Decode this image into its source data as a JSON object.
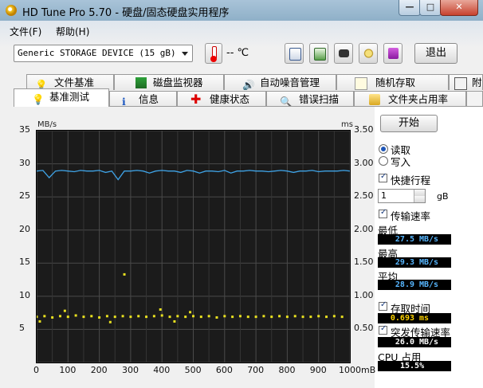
{
  "window": {
    "title": "HD Tune Pro 5.70 - 硬盘/固态硬盘实用程序",
    "min_label": "—",
    "max_label": "□",
    "close_label": "✕"
  },
  "menu": {
    "file": "文件(F)",
    "help": "帮助(H)"
  },
  "toolbar": {
    "device": "Generic STORAGE DEVICE (15 gB)",
    "temperature": "-- ℃",
    "exit_label": "退出",
    "icons": [
      "copy-text-icon",
      "copy-info-icon",
      "camera-icon",
      "options-icon",
      "save-icon"
    ]
  },
  "tabs": {
    "row1": [
      "文件基准",
      "磁盘监视器",
      "自动噪音管理",
      "随机存取",
      "附"
    ],
    "row2": [
      "基准测试",
      "信息",
      "健康状态",
      "错误扫描",
      "文件夹占用率"
    ]
  },
  "graph": {
    "left_unit": "MB/s",
    "right_unit": "ms"
  },
  "side": {
    "start_label": "开始",
    "read_label": "读取",
    "write_label": "写入",
    "short_stroke_label": "快捷行程",
    "short_stroke_value": "1",
    "short_stroke_unit": "gB",
    "transfer_rate_label": "传输速率",
    "min_label": "最低",
    "min_value": "27.5",
    "min_unit": "MB/s",
    "max_label": "最高",
    "max_value": "29.3",
    "max_unit": "MB/s",
    "avg_label": "平均",
    "avg_value": "28.9",
    "avg_unit": "MB/s",
    "access_time_label": "存取时间",
    "access_time_value": "0.693",
    "access_time_unit": "ms",
    "burst_rate_label": "突发传输速率",
    "burst_rate_value": "26.0",
    "burst_rate_unit": "MB/s",
    "cpu_label": "CPU 占用",
    "cpu_value": "15.5%"
  },
  "chart_data": {
    "type": "line",
    "x_ticks": [
      "0",
      "100",
      "200",
      "300",
      "400",
      "500",
      "600",
      "700",
      "800",
      "900",
      "1000mB"
    ],
    "xlim": [
      0,
      1000
    ],
    "y_left_ticks": [
      "35",
      "30",
      "25",
      "20",
      "15",
      "10",
      "5"
    ],
    "y_right_ticks": [
      "3.50",
      "3.00",
      "2.50",
      "2.00",
      "1.50",
      "1.00",
      "0.50"
    ],
    "ylim_left": [
      0,
      35
    ],
    "ylim_right": [
      0,
      3.5
    ],
    "grid": true,
    "series": [
      {
        "color": "#3fa3e6",
        "axis": "left",
        "x": [
          0,
          20,
          40,
          60,
          80,
          100,
          120,
          140,
          160,
          180,
          200,
          220,
          240,
          260,
          280,
          300,
          320,
          340,
          360,
          380,
          400,
          420,
          440,
          460,
          480,
          500,
          520,
          540,
          560,
          580,
          600,
          620,
          640,
          660,
          680,
          700,
          720,
          740,
          760,
          780,
          800,
          820,
          840,
          860,
          880,
          900,
          920,
          940,
          960,
          980,
          1000
        ],
        "y": [
          28.9,
          29.0,
          27.9,
          28.9,
          29.0,
          28.9,
          28.8,
          29.0,
          28.9,
          28.9,
          29.0,
          28.7,
          28.9,
          27.6,
          28.9,
          28.9,
          29.0,
          28.9,
          28.6,
          28.9,
          29.0,
          28.9,
          28.9,
          28.7,
          29.0,
          28.9,
          28.6,
          28.9,
          28.9,
          28.8,
          29.0,
          28.6,
          28.9,
          28.9,
          29.0,
          28.9,
          28.9,
          28.8,
          28.9,
          29.0,
          28.9,
          28.7,
          28.9,
          28.9,
          29.0,
          28.8,
          28.9,
          28.9,
          28.9,
          29.0,
          28.9
        ]
      },
      {
        "color": "#e8e020",
        "axis": "right",
        "style": "points",
        "x": [
          0,
          25,
          50,
          75,
          100,
          125,
          150,
          175,
          200,
          225,
          250,
          275,
          300,
          325,
          350,
          375,
          400,
          425,
          450,
          475,
          500,
          525,
          550,
          575,
          600,
          625,
          650,
          675,
          700,
          725,
          750,
          775,
          800,
          825,
          850,
          875,
          900,
          925,
          950,
          975
        ],
        "y": [
          0.69,
          0.7,
          0.68,
          0.7,
          0.69,
          0.71,
          0.69,
          0.7,
          0.68,
          0.7,
          0.69,
          0.7,
          0.69,
          0.7,
          0.69,
          0.7,
          0.71,
          0.69,
          0.7,
          0.69,
          0.7,
          0.69,
          0.7,
          0.68,
          0.7,
          0.69,
          0.7,
          0.69,
          0.69,
          0.7,
          0.69,
          0.7,
          0.69,
          0.7,
          0.69,
          0.69,
          0.7,
          0.69,
          0.7,
          0.69
        ]
      },
      {
        "color": "#e8e020",
        "axis": "right",
        "style": "points",
        "x": [
          10,
          90,
          235,
          280,
          395,
          440,
          490
        ],
        "y": [
          0.62,
          0.78,
          0.61,
          1.33,
          0.8,
          0.62,
          0.76
        ]
      }
    ]
  }
}
